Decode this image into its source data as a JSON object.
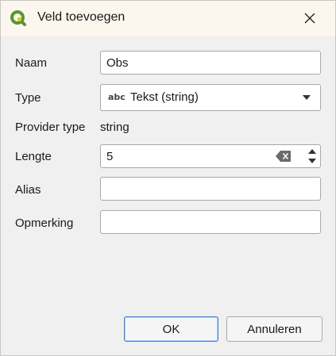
{
  "dialog": {
    "title": "Veld toevoegen",
    "icon": "qgis-logo-icon",
    "close_icon": "close-icon"
  },
  "form": {
    "name_label": "Naam",
    "name_value": "Obs",
    "type_label": "Type",
    "type_icon_text": "abc",
    "type_value": "Tekst (string)",
    "provider_type_label": "Provider type",
    "provider_type_value": "string",
    "length_label": "Lengte",
    "length_value": "5",
    "alias_label": "Alias",
    "alias_value": "",
    "comment_label": "Opmerking",
    "comment_value": ""
  },
  "buttons": {
    "ok_label": "OK",
    "cancel_label": "Annuleren"
  },
  "colors": {
    "qgis_green": "#589632",
    "qgis_yellow": "#eec311",
    "ok_border": "#3a7bd5"
  }
}
